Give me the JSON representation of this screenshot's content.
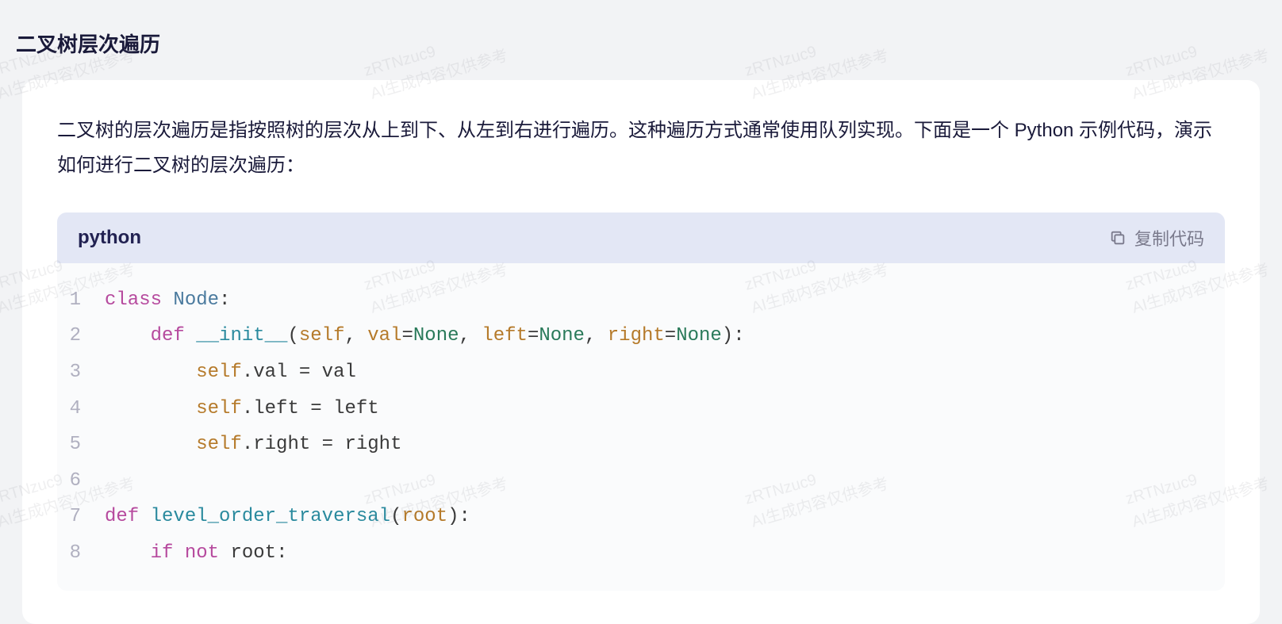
{
  "header": {
    "title": "二叉树层次遍历"
  },
  "content": {
    "intro": "二叉树的层次遍历是指按照树的层次从上到下、从左到右进行遍历。这种遍历方式通常使用队列实现。下面是一个 Python 示例代码，演示如何进行二叉树的层次遍历："
  },
  "code_block": {
    "language": "python",
    "copy_label": "复制代码",
    "lines": [
      {
        "n": "1",
        "tokens": [
          [
            "kw",
            "class"
          ],
          [
            "txt",
            " "
          ],
          [
            "cls",
            "Node"
          ],
          [
            "punct",
            ":"
          ]
        ]
      },
      {
        "n": "2",
        "tokens": [
          [
            "txt",
            "    "
          ],
          [
            "kw",
            "def"
          ],
          [
            "txt",
            " "
          ],
          [
            "fn",
            "__init__"
          ],
          [
            "punct",
            "("
          ],
          [
            "param",
            "self"
          ],
          [
            "punct",
            ", "
          ],
          [
            "param",
            "val"
          ],
          [
            "punct",
            "="
          ],
          [
            "lit",
            "None"
          ],
          [
            "punct",
            ", "
          ],
          [
            "param",
            "left"
          ],
          [
            "punct",
            "="
          ],
          [
            "lit",
            "None"
          ],
          [
            "punct",
            ", "
          ],
          [
            "param",
            "right"
          ],
          [
            "punct",
            "="
          ],
          [
            "lit",
            "None"
          ],
          [
            "punct",
            "):"
          ]
        ]
      },
      {
        "n": "3",
        "tokens": [
          [
            "txt",
            "        "
          ],
          [
            "param",
            "self"
          ],
          [
            "punct",
            "."
          ],
          [
            "attr",
            "val"
          ],
          [
            "txt",
            " "
          ],
          [
            "punct",
            "="
          ],
          [
            "txt",
            " "
          ],
          [
            "attr",
            "val"
          ]
        ]
      },
      {
        "n": "4",
        "tokens": [
          [
            "txt",
            "        "
          ],
          [
            "param",
            "self"
          ],
          [
            "punct",
            "."
          ],
          [
            "attr",
            "left"
          ],
          [
            "txt",
            " "
          ],
          [
            "punct",
            "="
          ],
          [
            "txt",
            " "
          ],
          [
            "attr",
            "left"
          ]
        ]
      },
      {
        "n": "5",
        "tokens": [
          [
            "txt",
            "        "
          ],
          [
            "param",
            "self"
          ],
          [
            "punct",
            "."
          ],
          [
            "attr",
            "right"
          ],
          [
            "txt",
            " "
          ],
          [
            "punct",
            "="
          ],
          [
            "txt",
            " "
          ],
          [
            "attr",
            "right"
          ]
        ]
      },
      {
        "n": "6",
        "tokens": []
      },
      {
        "n": "7",
        "tokens": [
          [
            "kw",
            "def"
          ],
          [
            "txt",
            " "
          ],
          [
            "fn",
            "level_order_traversal"
          ],
          [
            "punct",
            "("
          ],
          [
            "param",
            "root"
          ],
          [
            "punct",
            "):"
          ]
        ]
      },
      {
        "n": "8",
        "tokens": [
          [
            "txt",
            "    "
          ],
          [
            "kw",
            "if"
          ],
          [
            "txt",
            " "
          ],
          [
            "kw",
            "not"
          ],
          [
            "txt",
            " "
          ],
          [
            "attr",
            "root"
          ],
          [
            "punct",
            ":"
          ]
        ]
      }
    ]
  },
  "watermark": {
    "line1": "zRTNzuc9",
    "line2": "AI生成内容仅供参考"
  }
}
